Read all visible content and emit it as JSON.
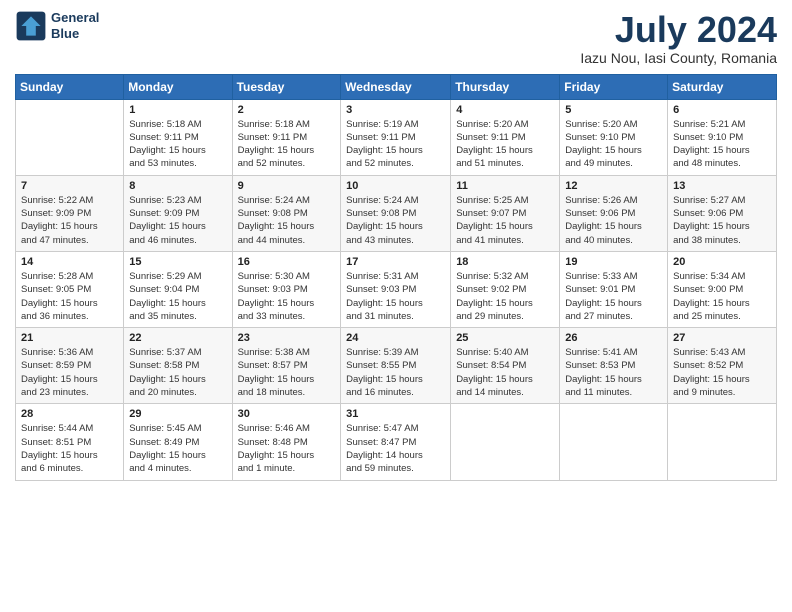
{
  "header": {
    "logo_line1": "General",
    "logo_line2": "Blue",
    "month": "July 2024",
    "location": "Iazu Nou, Iasi County, Romania"
  },
  "weekdays": [
    "Sunday",
    "Monday",
    "Tuesday",
    "Wednesday",
    "Thursday",
    "Friday",
    "Saturday"
  ],
  "weeks": [
    [
      {
        "day": "",
        "content": ""
      },
      {
        "day": "1",
        "content": "Sunrise: 5:18 AM\nSunset: 9:11 PM\nDaylight: 15 hours\nand 53 minutes."
      },
      {
        "day": "2",
        "content": "Sunrise: 5:18 AM\nSunset: 9:11 PM\nDaylight: 15 hours\nand 52 minutes."
      },
      {
        "day": "3",
        "content": "Sunrise: 5:19 AM\nSunset: 9:11 PM\nDaylight: 15 hours\nand 52 minutes."
      },
      {
        "day": "4",
        "content": "Sunrise: 5:20 AM\nSunset: 9:11 PM\nDaylight: 15 hours\nand 51 minutes."
      },
      {
        "day": "5",
        "content": "Sunrise: 5:20 AM\nSunset: 9:10 PM\nDaylight: 15 hours\nand 49 minutes."
      },
      {
        "day": "6",
        "content": "Sunrise: 5:21 AM\nSunset: 9:10 PM\nDaylight: 15 hours\nand 48 minutes."
      }
    ],
    [
      {
        "day": "7",
        "content": "Sunrise: 5:22 AM\nSunset: 9:09 PM\nDaylight: 15 hours\nand 47 minutes."
      },
      {
        "day": "8",
        "content": "Sunrise: 5:23 AM\nSunset: 9:09 PM\nDaylight: 15 hours\nand 46 minutes."
      },
      {
        "day": "9",
        "content": "Sunrise: 5:24 AM\nSunset: 9:08 PM\nDaylight: 15 hours\nand 44 minutes."
      },
      {
        "day": "10",
        "content": "Sunrise: 5:24 AM\nSunset: 9:08 PM\nDaylight: 15 hours\nand 43 minutes."
      },
      {
        "day": "11",
        "content": "Sunrise: 5:25 AM\nSunset: 9:07 PM\nDaylight: 15 hours\nand 41 minutes."
      },
      {
        "day": "12",
        "content": "Sunrise: 5:26 AM\nSunset: 9:06 PM\nDaylight: 15 hours\nand 40 minutes."
      },
      {
        "day": "13",
        "content": "Sunrise: 5:27 AM\nSunset: 9:06 PM\nDaylight: 15 hours\nand 38 minutes."
      }
    ],
    [
      {
        "day": "14",
        "content": "Sunrise: 5:28 AM\nSunset: 9:05 PM\nDaylight: 15 hours\nand 36 minutes."
      },
      {
        "day": "15",
        "content": "Sunrise: 5:29 AM\nSunset: 9:04 PM\nDaylight: 15 hours\nand 35 minutes."
      },
      {
        "day": "16",
        "content": "Sunrise: 5:30 AM\nSunset: 9:03 PM\nDaylight: 15 hours\nand 33 minutes."
      },
      {
        "day": "17",
        "content": "Sunrise: 5:31 AM\nSunset: 9:03 PM\nDaylight: 15 hours\nand 31 minutes."
      },
      {
        "day": "18",
        "content": "Sunrise: 5:32 AM\nSunset: 9:02 PM\nDaylight: 15 hours\nand 29 minutes."
      },
      {
        "day": "19",
        "content": "Sunrise: 5:33 AM\nSunset: 9:01 PM\nDaylight: 15 hours\nand 27 minutes."
      },
      {
        "day": "20",
        "content": "Sunrise: 5:34 AM\nSunset: 9:00 PM\nDaylight: 15 hours\nand 25 minutes."
      }
    ],
    [
      {
        "day": "21",
        "content": "Sunrise: 5:36 AM\nSunset: 8:59 PM\nDaylight: 15 hours\nand 23 minutes."
      },
      {
        "day": "22",
        "content": "Sunrise: 5:37 AM\nSunset: 8:58 PM\nDaylight: 15 hours\nand 20 minutes."
      },
      {
        "day": "23",
        "content": "Sunrise: 5:38 AM\nSunset: 8:57 PM\nDaylight: 15 hours\nand 18 minutes."
      },
      {
        "day": "24",
        "content": "Sunrise: 5:39 AM\nSunset: 8:55 PM\nDaylight: 15 hours\nand 16 minutes."
      },
      {
        "day": "25",
        "content": "Sunrise: 5:40 AM\nSunset: 8:54 PM\nDaylight: 15 hours\nand 14 minutes."
      },
      {
        "day": "26",
        "content": "Sunrise: 5:41 AM\nSunset: 8:53 PM\nDaylight: 15 hours\nand 11 minutes."
      },
      {
        "day": "27",
        "content": "Sunrise: 5:43 AM\nSunset: 8:52 PM\nDaylight: 15 hours\nand 9 minutes."
      }
    ],
    [
      {
        "day": "28",
        "content": "Sunrise: 5:44 AM\nSunset: 8:51 PM\nDaylight: 15 hours\nand 6 minutes."
      },
      {
        "day": "29",
        "content": "Sunrise: 5:45 AM\nSunset: 8:49 PM\nDaylight: 15 hours\nand 4 minutes."
      },
      {
        "day": "30",
        "content": "Sunrise: 5:46 AM\nSunset: 8:48 PM\nDaylight: 15 hours\nand 1 minute."
      },
      {
        "day": "31",
        "content": "Sunrise: 5:47 AM\nSunset: 8:47 PM\nDaylight: 14 hours\nand 59 minutes."
      },
      {
        "day": "",
        "content": ""
      },
      {
        "day": "",
        "content": ""
      },
      {
        "day": "",
        "content": ""
      }
    ]
  ]
}
